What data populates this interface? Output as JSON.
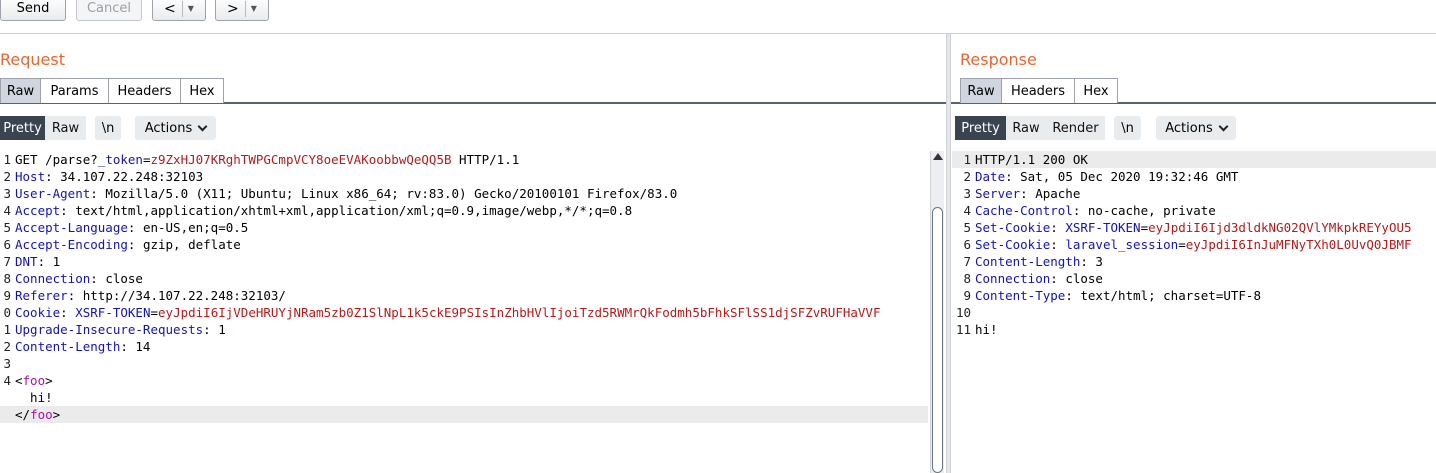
{
  "toolbar": {
    "send": "Send",
    "cancel": "Cancel",
    "back": "<",
    "forward": ">",
    "dropdown": "▼"
  },
  "request": {
    "title": "Request",
    "tabs": [
      "Raw",
      "Params",
      "Headers",
      "Hex"
    ],
    "active_tab": "Raw",
    "view_modes": [
      "Pretty",
      "Raw"
    ],
    "active_view": "Pretty",
    "newline_toggle": "\\n",
    "actions": "Actions",
    "lines": [
      {
        "n": "1",
        "parts": [
          [
            "GET /parse?",
            ""
          ],
          [
            "_token",
            "hn"
          ],
          [
            "=",
            ""
          ],
          [
            "z9ZxHJ07KRghTWPGCmpVCY8oeEVAKoobbwQeQQ5B",
            "red"
          ],
          [
            " HTTP/1.1",
            ""
          ]
        ]
      },
      {
        "n": "2",
        "parts": [
          [
            "Host",
            "hn"
          ],
          [
            ": 34.107.22.248:32103",
            ""
          ]
        ]
      },
      {
        "n": "3",
        "parts": [
          [
            "User-Agent",
            "hn"
          ],
          [
            ": Mozilla/5.0 (X11; Ubuntu; Linux x86_64; rv:83.0) Gecko/20100101 Firefox/83.0",
            ""
          ]
        ]
      },
      {
        "n": "4",
        "parts": [
          [
            "Accept",
            "hn"
          ],
          [
            ": text/html,application/xhtml+xml,application/xml;q=0.9,image/webp,*/*;q=0.8",
            ""
          ]
        ]
      },
      {
        "n": "5",
        "parts": [
          [
            "Accept-Language",
            "hn"
          ],
          [
            ": en-US,en;q=0.5",
            ""
          ]
        ]
      },
      {
        "n": "6",
        "parts": [
          [
            "Accept-Encoding",
            "hn"
          ],
          [
            ": gzip, deflate",
            ""
          ]
        ]
      },
      {
        "n": "7",
        "parts": [
          [
            "DNT",
            "hn"
          ],
          [
            ": 1",
            ""
          ]
        ]
      },
      {
        "n": "8",
        "parts": [
          [
            "Connection",
            "hn"
          ],
          [
            ": close",
            ""
          ]
        ]
      },
      {
        "n": "9",
        "parts": [
          [
            "Referer",
            "hn"
          ],
          [
            ": http://34.107.22.248:32103/",
            ""
          ]
        ]
      },
      {
        "n": "0",
        "parts": [
          [
            "Cookie",
            "hn"
          ],
          [
            ": ",
            ""
          ],
          [
            "XSRF-TOKEN",
            "hn"
          ],
          [
            "=",
            ""
          ],
          [
            "eyJpdiI6IjVDeHRUYjNRam5zb0Z1SlNpL1k5ckE9PSIsInZhbHVlIjoiTzd5RWMrQkFodmh5bFhkSFlSS1djSFZvRUFHaVVF",
            "red"
          ]
        ]
      },
      {
        "n": "1",
        "parts": [
          [
            "Upgrade-Insecure-Requests",
            "hn"
          ],
          [
            ": 1",
            ""
          ]
        ]
      },
      {
        "n": "2",
        "parts": [
          [
            "Content-Length",
            "hn"
          ],
          [
            ": 14",
            ""
          ]
        ]
      },
      {
        "n": "3",
        "parts": []
      },
      {
        "n": "4",
        "parts": [
          [
            "<",
            ""
          ],
          [
            "foo",
            "mag"
          ],
          [
            ">",
            ""
          ]
        ]
      },
      {
        "n": "",
        "parts": [
          [
            "  hi!",
            ""
          ]
        ]
      },
      {
        "n": "",
        "parts": [
          [
            "</",
            ""
          ],
          [
            "foo",
            "mag"
          ],
          [
            ">",
            ""
          ]
        ],
        "hl": true
      }
    ]
  },
  "response": {
    "title": "Response",
    "tabs": [
      "Raw",
      "Headers",
      "Hex"
    ],
    "active_tab": "Raw",
    "view_modes": [
      "Pretty",
      "Raw",
      "Render"
    ],
    "active_view": "Pretty",
    "newline_toggle": "\\n",
    "actions": "Actions",
    "lines": [
      {
        "n": "1",
        "parts": [
          [
            "HTTP/1.1 200 OK",
            ""
          ]
        ],
        "hl": true
      },
      {
        "n": "2",
        "parts": [
          [
            "Date",
            "hn"
          ],
          [
            ": Sat, 05 Dec 2020 19:32:46 GMT",
            ""
          ]
        ]
      },
      {
        "n": "3",
        "parts": [
          [
            "Server",
            "hn"
          ],
          [
            ": Apache",
            ""
          ]
        ]
      },
      {
        "n": "4",
        "parts": [
          [
            "Cache-Control",
            "hn"
          ],
          [
            ": no-cache, private",
            ""
          ]
        ]
      },
      {
        "n": "5",
        "parts": [
          [
            "Set-Cookie",
            "hn"
          ],
          [
            ": ",
            ""
          ],
          [
            "XSRF-TOKEN",
            "hn"
          ],
          [
            "=",
            ""
          ],
          [
            "eyJpdiI6Ijd3dldkNG02QVlYMkpkREYyOU5",
            "red"
          ]
        ]
      },
      {
        "n": "6",
        "parts": [
          [
            "Set-Cookie",
            "hn"
          ],
          [
            ": ",
            ""
          ],
          [
            "laravel_session",
            "hn"
          ],
          [
            "=",
            ""
          ],
          [
            "eyJpdiI6InJuMFNyTXh0L0UvQ0JBMF",
            "red"
          ]
        ]
      },
      {
        "n": "7",
        "parts": [
          [
            "Content-Length",
            "hn"
          ],
          [
            ": 3",
            ""
          ]
        ]
      },
      {
        "n": "8",
        "parts": [
          [
            "Connection",
            "hn"
          ],
          [
            ": close",
            ""
          ]
        ]
      },
      {
        "n": "9",
        "parts": [
          [
            "Content-Type",
            "hn"
          ],
          [
            ": text/html; charset=UTF-8",
            ""
          ]
        ]
      },
      {
        "n": "10",
        "parts": []
      },
      {
        "n": "11",
        "parts": [
          [
            "hi!",
            ""
          ]
        ]
      }
    ]
  }
}
